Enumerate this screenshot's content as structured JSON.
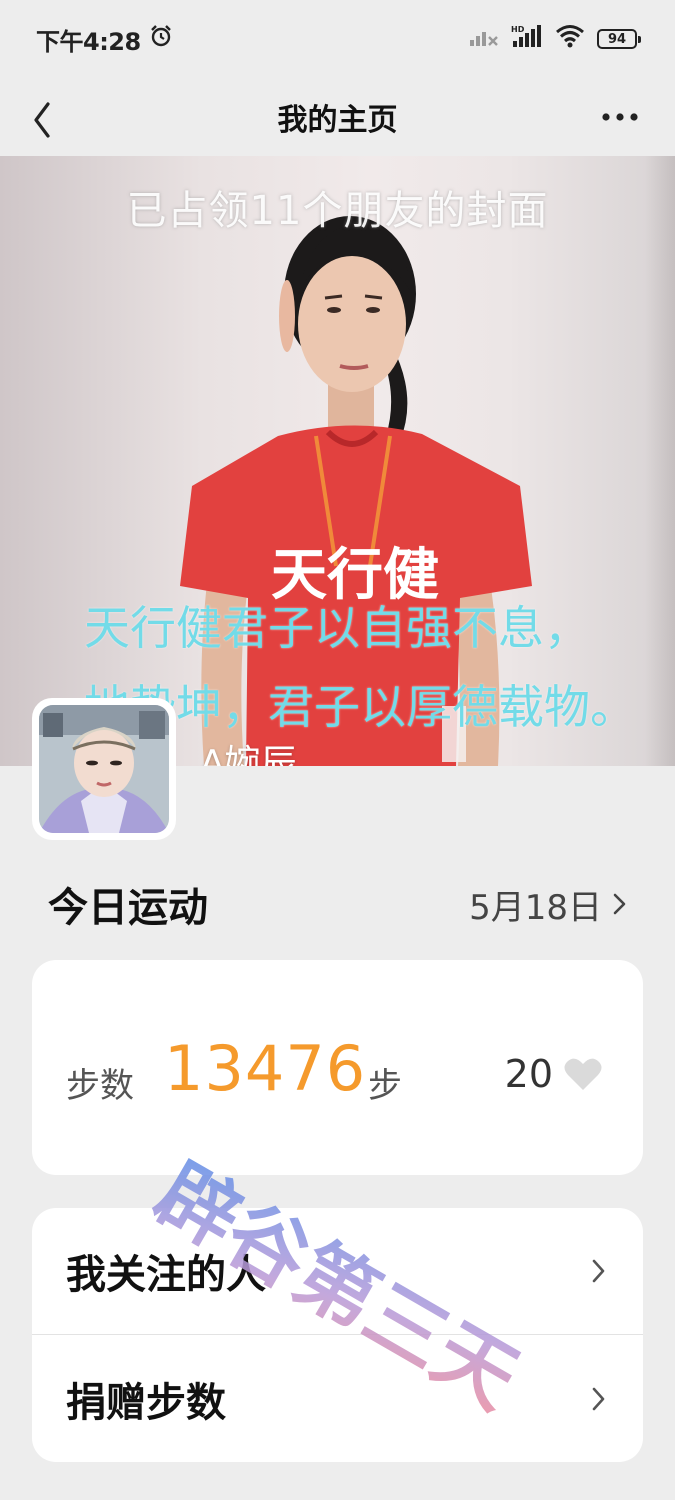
{
  "status_bar": {
    "time": "下午4:28",
    "battery": "94"
  },
  "nav": {
    "title": "我的主页"
  },
  "cover": {
    "caption": "已占领11个朋友的封面",
    "shirt_text": "天行健",
    "overlay_line1": "天行健君子以自强不息，",
    "overlay_line2": "地势坤，君子以厚德载物。",
    "username": "A婉辰"
  },
  "today": {
    "title": "今日运动",
    "date": "5月18日"
  },
  "steps": {
    "label": "步数",
    "value": "13476",
    "unit": "步",
    "likes": "20"
  },
  "menu": {
    "items": [
      {
        "label": "我关注的人"
      },
      {
        "label": "捐赠步数"
      }
    ]
  },
  "watermark": {
    "text": "辟谷第三天"
  },
  "colors": {
    "steps_value": "#f59a2c",
    "page_bg": "#ededed",
    "overlay_text": "#72dbe8",
    "shirt": "#e2413f"
  }
}
